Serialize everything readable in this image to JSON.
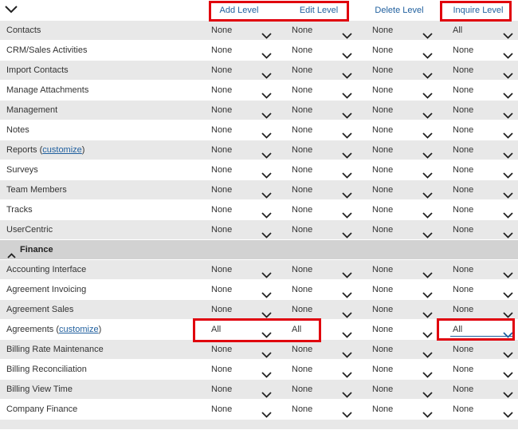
{
  "columns": [
    "Add Level",
    "Edit Level",
    "Delete Level",
    "Inquire Level"
  ],
  "rows": [
    {
      "type": "item",
      "label": "Contacts",
      "values": [
        "None",
        "None",
        "None",
        "All"
      ]
    },
    {
      "type": "item",
      "label": "CRM/Sales Activities",
      "values": [
        "None",
        "None",
        "None",
        "None"
      ]
    },
    {
      "type": "item",
      "label": "Import Contacts",
      "values": [
        "None",
        "None",
        "None",
        "None"
      ]
    },
    {
      "type": "item",
      "label": "Manage Attachments",
      "values": [
        "None",
        "None",
        "None",
        "None"
      ]
    },
    {
      "type": "item",
      "label": "Management",
      "values": [
        "None",
        "None",
        "None",
        "None"
      ]
    },
    {
      "type": "item",
      "label": "Notes",
      "values": [
        "None",
        "None",
        "None",
        "None"
      ]
    },
    {
      "type": "item",
      "label": "Reports",
      "link": "customize",
      "values": [
        "None",
        "None",
        "None",
        "None"
      ]
    },
    {
      "type": "item",
      "label": "Surveys",
      "values": [
        "None",
        "None",
        "None",
        "None"
      ]
    },
    {
      "type": "item",
      "label": "Team Members",
      "values": [
        "None",
        "None",
        "None",
        "None"
      ]
    },
    {
      "type": "item",
      "label": "Tracks",
      "values": [
        "None",
        "None",
        "None",
        "None"
      ]
    },
    {
      "type": "item",
      "label": "UserCentric",
      "values": [
        "None",
        "None",
        "None",
        "None"
      ]
    },
    {
      "type": "section",
      "label": "Finance"
    },
    {
      "type": "item",
      "label": "Accounting Interface",
      "values": [
        "None",
        "None",
        "None",
        "None"
      ]
    },
    {
      "type": "item",
      "label": "Agreement Invoicing",
      "values": [
        "None",
        "None",
        "None",
        "None"
      ]
    },
    {
      "type": "item",
      "label": "Agreement Sales",
      "values": [
        "None",
        "None",
        "None",
        "None"
      ]
    },
    {
      "type": "item",
      "label": "Agreements",
      "link": "customize",
      "values": [
        "All",
        "All",
        "None",
        "All"
      ],
      "focused": 3
    },
    {
      "type": "item",
      "label": "Billing Rate Maintenance",
      "values": [
        "None",
        "None",
        "None",
        "None"
      ]
    },
    {
      "type": "item",
      "label": "Billing Reconciliation",
      "values": [
        "None",
        "None",
        "None",
        "None"
      ]
    },
    {
      "type": "item",
      "label": "Billing View Time",
      "values": [
        "None",
        "None",
        "None",
        "None"
      ]
    },
    {
      "type": "item",
      "label": "Company Finance",
      "values": [
        "None",
        "None",
        "None",
        "None"
      ]
    },
    {
      "type": "item",
      "label": "",
      "values": [
        "",
        "",
        "",
        ""
      ],
      "clipped": true
    }
  ],
  "colors": {
    "highlight": "#e0000d",
    "link": "#1f5f9e",
    "focus": "#1f5f9e"
  },
  "icons": {
    "collapse_all": "chevron-down-icon",
    "section_toggle": "chevron-up-icon",
    "dropdown": "chevron-down-icon"
  }
}
